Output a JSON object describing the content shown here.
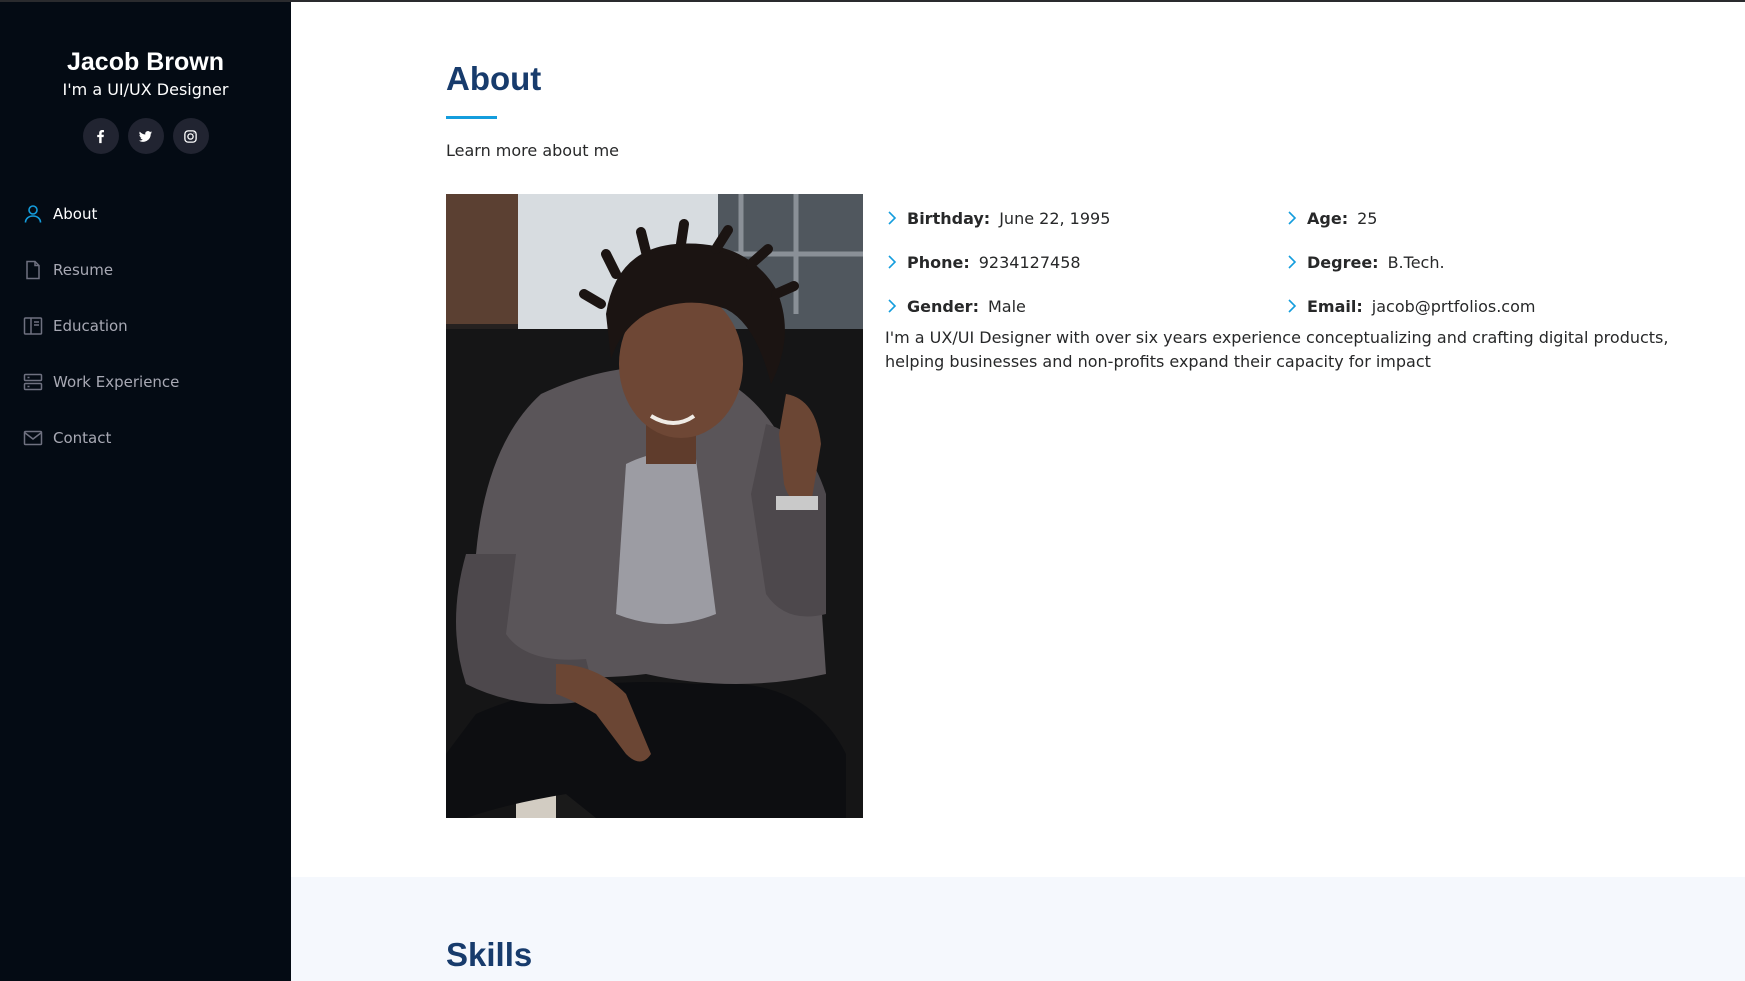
{
  "sidebar": {
    "name": "Jacob Brown",
    "tagline": "I'm a UI/UX Designer",
    "social": [
      "facebook-icon",
      "twitter-icon",
      "instagram-icon"
    ],
    "nav": [
      {
        "label": "About",
        "icon": "person-icon",
        "active": true
      },
      {
        "label": "Resume",
        "icon": "file-icon",
        "active": false
      },
      {
        "label": "Education",
        "icon": "book-icon",
        "active": false
      },
      {
        "label": "Work Experience",
        "icon": "server-icon",
        "active": false
      },
      {
        "label": "Contact",
        "icon": "envelope-icon",
        "active": false
      }
    ]
  },
  "about": {
    "title": "About",
    "subtitle": "Learn more about me",
    "photo_icon": "portrait-photo",
    "info": [
      {
        "label": "Birthday:",
        "value": "June 22, 1995"
      },
      {
        "label": "Age:",
        "value": "25"
      },
      {
        "label": "Phone:",
        "value": "9234127458"
      },
      {
        "label": "Degree:",
        "value": "B.Tech."
      },
      {
        "label": "Gender:",
        "value": "Male"
      },
      {
        "label": "Email:",
        "value": "jacob@prtfolios.com"
      }
    ],
    "description": "I'm a UX/UI Designer with over six years experience conceptualizing and crafting digital products, helping businesses and non-profits expand their capacity for impact"
  },
  "skills": {
    "title": "Skills"
  },
  "colors": {
    "sidebar_bg": "#040b14",
    "accent": "#149ddd",
    "heading": "#173b6c",
    "skills_bg": "#f5f8fd"
  }
}
